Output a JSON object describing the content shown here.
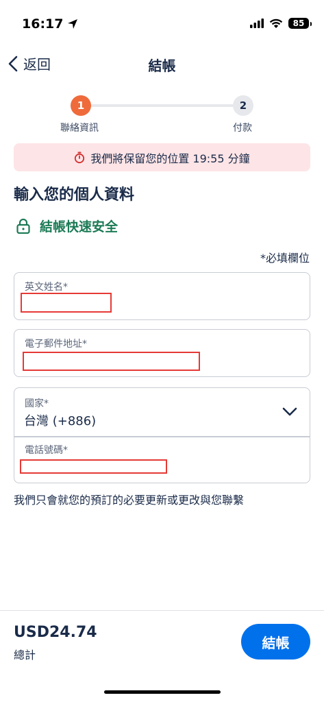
{
  "status_bar": {
    "time": "16:17",
    "battery": "85"
  },
  "header": {
    "back_label": "返回",
    "title": "結帳"
  },
  "stepper": {
    "steps": [
      {
        "number": "1",
        "label": "聯絡資訊"
      },
      {
        "number": "2",
        "label": "付款"
      }
    ]
  },
  "timer_banner": {
    "text": "我們將保留您的位置 19:55 分鐘"
  },
  "form": {
    "section_title": "輸入您的個人資料",
    "secure_text": "結帳快速安全",
    "required_note": "*必填欄位",
    "name_label": "英文姓名*",
    "email_label": "電子郵件地址*",
    "country_label": "國家*",
    "country_value": "台灣 (+886)",
    "phone_label": "電話號碼*",
    "contact_note": "我們只會就您的預訂的必要更新或更改與您聯繫"
  },
  "footer": {
    "total_amount": "USD24.74",
    "total_label": "總計",
    "checkout_label": "結帳"
  },
  "colors": {
    "accent": "#0071eb",
    "step_active": "#ef6b3b",
    "secure_green": "#1b7a55",
    "banner_bg": "#fde4e6"
  }
}
